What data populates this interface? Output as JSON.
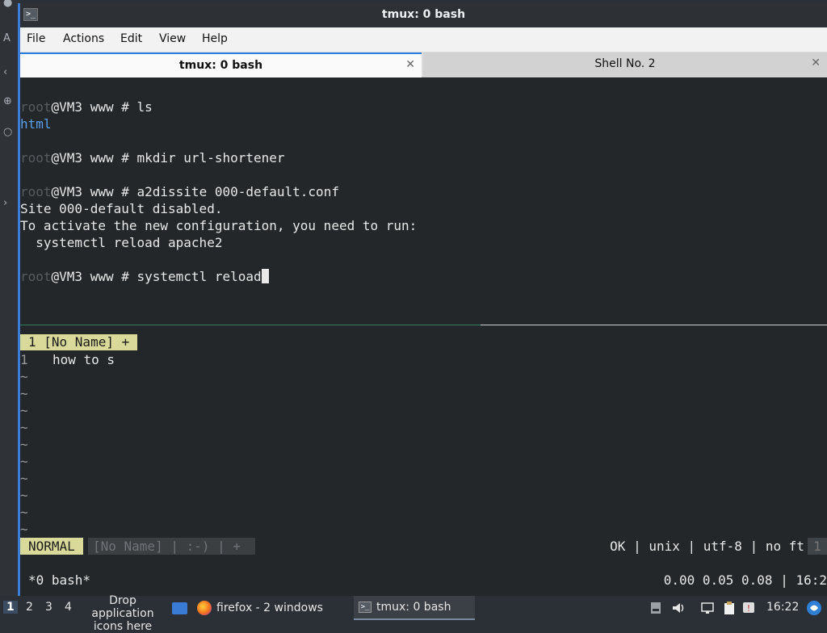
{
  "window": {
    "title": "tmux: 0 bash",
    "icon_glyph": ">_"
  },
  "menu": [
    "File",
    "Actions",
    "Edit",
    "View",
    "Help"
  ],
  "tabs": [
    {
      "label": "tmux: 0 bash",
      "close": "✕",
      "active": true
    },
    {
      "label": "Shell No. 2",
      "close": "✕",
      "active": false
    }
  ],
  "terminal": {
    "prompt_user": "root",
    "lines": [
      {
        "prompt": "@VM3 www # ",
        "cmd": "ls"
      },
      {
        "out": "html",
        "color": "#5aa0ee"
      },
      {
        "prompt": "@VM3 www # ",
        "cmd": "mkdir url-shortener"
      },
      {
        "prompt": "@VM3 www # ",
        "cmd": "a2dissite 000-default.conf"
      },
      {
        "out": "Site 000-default disabled."
      },
      {
        "out": "To activate the new configuration, you need to run:"
      },
      {
        "out": "  systemctl reload apache2"
      },
      {
        "prompt": "@VM3 www # ",
        "cmd": "systemctl reload"
      }
    ]
  },
  "vim": {
    "tabline": "1 [No Name] +",
    "buffer_line_number": "1",
    "buffer_line_text": "how to s",
    "tilde": "~",
    "mode": "NORMAL",
    "file_section": "[No Name] | :-) | +",
    "right_section": "OK | unix | utf-8 | no ft",
    "right_tail": "1"
  },
  "tmux": {
    "left": "*0 bash*",
    "right": "0.00 0.05 0.08 | 16:2"
  },
  "taskbar": {
    "workspaces": [
      "1",
      "2",
      "3",
      "4"
    ],
    "drop_text": "Drop application icons here",
    "firefox": "firefox - 2 windows",
    "terminal": "tmux: 0 bash",
    "clock": "16:22"
  },
  "background": {
    "left_glyphs": [
      "A",
      "‹",
      "⊕",
      "○",
      "›"
    ]
  }
}
